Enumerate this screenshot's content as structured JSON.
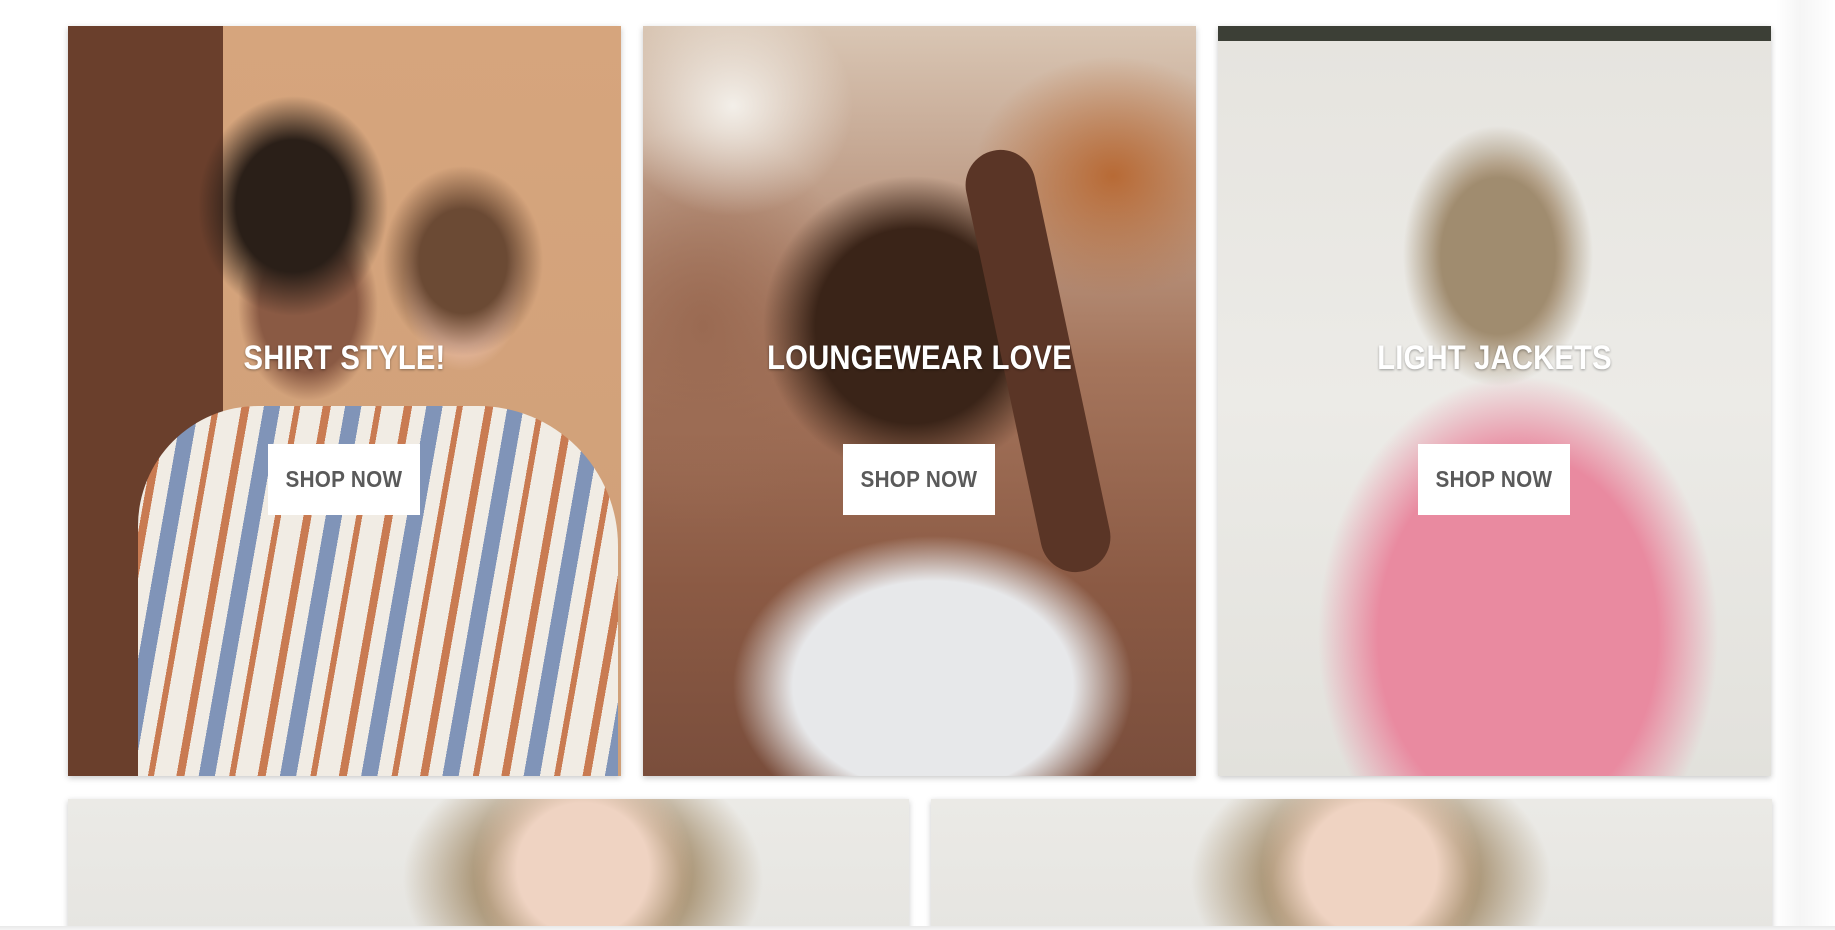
{
  "promo_grid": {
    "tiles": [
      {
        "title": "SHIRT STYLE!",
        "button_label": "SHOP NOW",
        "image_alt": "Two women wearing striped and brown shirts"
      },
      {
        "title": "LOUNGEWEAR LOVE",
        "button_label": "SHOP NOW",
        "image_alt": "Woman with curly hair in white t-shirt outdoors"
      },
      {
        "title": "LIGHT JACKETS",
        "button_label": "SHOP NOW",
        "image_alt": "Woman in pink jacket against white backdrop"
      }
    ],
    "second_row": [
      {
        "image_alt": "Woman with blonde bob, cropped"
      },
      {
        "image_alt": "Woman with blonde bob, cropped"
      }
    ]
  },
  "colors": {
    "button_bg": "#ffffff",
    "button_text": "#5a5a5a",
    "title_text": "#ffffff",
    "page_bg": "#ffffff"
  }
}
